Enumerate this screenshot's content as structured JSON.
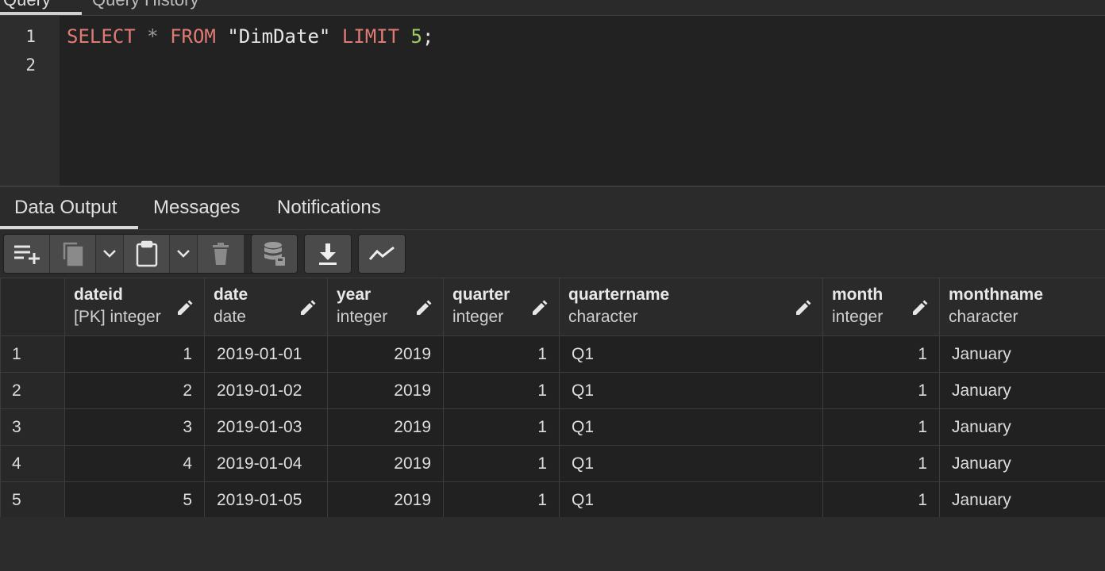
{
  "top_tabs": [
    "Query",
    "Query History"
  ],
  "editor": {
    "line_numbers": [
      "1",
      "2"
    ],
    "tokens": {
      "select": "SELECT",
      "star": " * ",
      "from": "FROM",
      "space1": " ",
      "table": "\"DimDate\"",
      "space2": " ",
      "limit": "LIMIT",
      "space3": " ",
      "limit_value": "5",
      "semicolon": ";"
    }
  },
  "result_tabs": [
    "Data Output",
    "Messages",
    "Notifications"
  ],
  "toolbar": {
    "icons": [
      "add-row-icon",
      "copy-icon",
      "chevron-down-icon",
      "paste-icon",
      "chevron-down-icon",
      "delete-icon",
      "save-data-icon",
      "download-icon",
      "graph-icon"
    ]
  },
  "columns": [
    {
      "name": "dateid",
      "type": "[PK] integer"
    },
    {
      "name": "date",
      "type": "date"
    },
    {
      "name": "year",
      "type": "integer"
    },
    {
      "name": "quarter",
      "type": "integer"
    },
    {
      "name": "quartername",
      "type": "character"
    },
    {
      "name": "month",
      "type": "integer"
    },
    {
      "name": "monthname",
      "type": "character"
    }
  ],
  "rows": [
    {
      "n": "1",
      "dateid": "1",
      "date": "2019-01-01",
      "year": "2019",
      "quarter": "1",
      "quartername": "Q1",
      "month": "1",
      "monthname": "January"
    },
    {
      "n": "2",
      "dateid": "2",
      "date": "2019-01-02",
      "year": "2019",
      "quarter": "1",
      "quartername": "Q1",
      "month": "1",
      "monthname": "January"
    },
    {
      "n": "3",
      "dateid": "3",
      "date": "2019-01-03",
      "year": "2019",
      "quarter": "1",
      "quartername": "Q1",
      "month": "1",
      "monthname": "January"
    },
    {
      "n": "4",
      "dateid": "4",
      "date": "2019-01-04",
      "year": "2019",
      "quarter": "1",
      "quartername": "Q1",
      "month": "1",
      "monthname": "January"
    },
    {
      "n": "5",
      "dateid": "5",
      "date": "2019-01-05",
      "year": "2019",
      "quarter": "1",
      "quartername": "Q1",
      "month": "1",
      "monthname": "January"
    }
  ],
  "colors": {
    "keyword": "#e07b74",
    "number": "#9ccc65",
    "background": "#222222"
  }
}
